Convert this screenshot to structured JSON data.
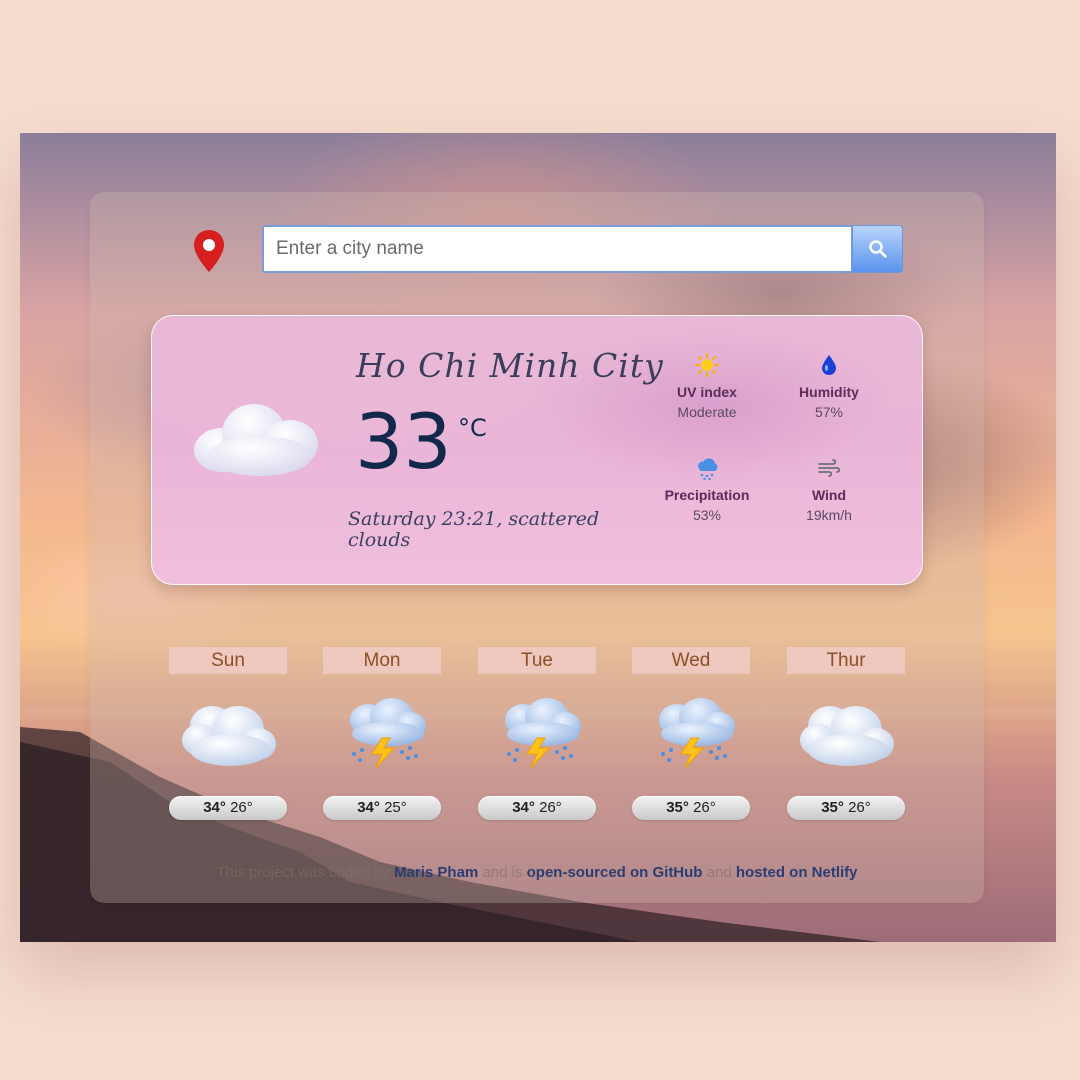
{
  "search": {
    "placeholder": "Enter a city name"
  },
  "current": {
    "city": "Ho Chi Minh City",
    "temperature": "33",
    "unit": "°C",
    "description": "Saturday 23:21, scattered clouds",
    "icon": "cloud-icon",
    "stats": [
      {
        "icon": "sun-icon",
        "label": "UV index",
        "value": "Moderate"
      },
      {
        "icon": "water-drop-icon",
        "label": "Humidity",
        "value": "57%"
      },
      {
        "icon": "rain-cloud-icon",
        "label": "Precipitation",
        "value": "53%"
      },
      {
        "icon": "wind-icon",
        "label": "Wind",
        "value": "19km/h"
      }
    ]
  },
  "forecast": [
    {
      "day": "Sun",
      "icon": "cloud-icon",
      "high": "34°",
      "low": "26°"
    },
    {
      "day": "Mon",
      "icon": "thunderstorm-icon",
      "high": "34°",
      "low": "25°"
    },
    {
      "day": "Tue",
      "icon": "thunderstorm-icon",
      "high": "34°",
      "low": "26°"
    },
    {
      "day": "Wed",
      "icon": "thunderstorm-icon",
      "high": "35°",
      "low": "26°"
    },
    {
      "day": "Thur",
      "icon": "cloud-icon",
      "high": "35°",
      "low": "26°"
    }
  ],
  "footer": {
    "text_1": "This project was coded by",
    "author": "Maris Pham",
    "text_2": "and is",
    "github": "open-sourced on GitHub",
    "text_3": "and",
    "netlify": "hosted on Netlify"
  },
  "colors": {
    "page_bg": "#f5dccf",
    "accent_blue": "#5a94ee",
    "pin_red": "#d61f1f",
    "temp_text": "#13294b",
    "day_label": "#8c4f26"
  }
}
